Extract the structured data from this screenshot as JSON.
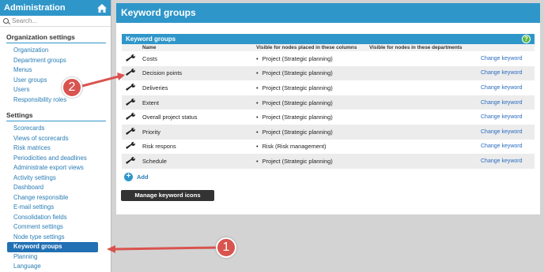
{
  "sidebar": {
    "title": "Administration",
    "search_placeholder": "Search...",
    "org_section": "Organization settings",
    "org_items": [
      "Organization",
      "Department groups",
      "Menus",
      "User groups",
      "Users",
      "Responsibility roles"
    ],
    "settings_section": "Settings",
    "settings_items": [
      "Scorecards",
      "Views of scorecards",
      "Risk matrices",
      "Periodicities and deadlines",
      "Administrate export views",
      "Activity settings",
      "Dashboard",
      "Change responsible",
      "E-mail settings",
      "Consolidation fields",
      "Comment settings",
      "Node type settings",
      "Keyword groups",
      "Planning",
      "Language"
    ],
    "active_item": "Keyword groups"
  },
  "main": {
    "title": "Keyword groups",
    "panel_title": "Keyword groups",
    "columns": {
      "name": "Name",
      "columns": "Visible for nodes placed in these columns",
      "departments": "Visible for nodes in these departments"
    },
    "rows": [
      {
        "name": "Costs",
        "column": "Project (Strategic planning)",
        "action": "Change keyword"
      },
      {
        "name": "Decision points",
        "column": "Project (Strategic planning)",
        "action": "Change keyword"
      },
      {
        "name": "Deliveries",
        "column": "Project (Strategic planning)",
        "action": "Change keyword"
      },
      {
        "name": "Extent",
        "column": "Project (Strategic planning)",
        "action": "Change keyword"
      },
      {
        "name": "Overall project status",
        "column": "Project (Strategic planning)",
        "action": "Change keyword"
      },
      {
        "name": "Priority",
        "column": "Project (Strategic planning)",
        "action": "Change keyword"
      },
      {
        "name": "Risk respons",
        "column": "Risk (Risk management)",
        "action": "Change keyword"
      },
      {
        "name": "Schedule",
        "column": "Project (Strategic planning)",
        "action": "Change keyword"
      }
    ],
    "add_label": "Add",
    "manage_button": "Manage keyword icons"
  },
  "callouts": [
    "1",
    "2"
  ],
  "colors": {
    "accent": "#2f96c9",
    "active": "#2170b4",
    "callout": "#d9534f",
    "help": "#5ab83a"
  }
}
